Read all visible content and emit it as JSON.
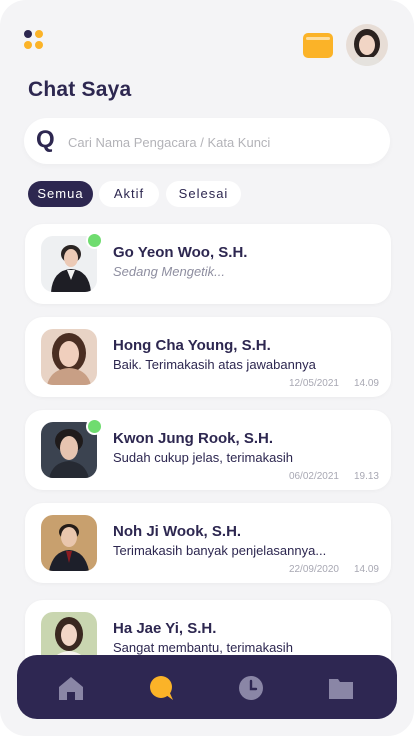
{
  "header": {
    "title": "Chat Saya",
    "menu_icon": "grid-dots-icon",
    "wallet_icon": "wallet-icon",
    "avatar_icon": "profile-avatar"
  },
  "search": {
    "icon_glyph": "Q",
    "placeholder": "Cari Nama Pengacara / Kata Kunci"
  },
  "filters": [
    {
      "label": "Semua",
      "active": true
    },
    {
      "label": "Aktif",
      "active": false
    },
    {
      "label": "Selesai",
      "active": false
    }
  ],
  "chats": [
    {
      "name": "Go Yeon Woo, S.H.",
      "message": "Sedang Mengetik...",
      "date": "",
      "time": "",
      "online": true,
      "typing": true
    },
    {
      "name": "Hong Cha Young, S.H.",
      "message": "Baik. Terimakasih atas jawabannya",
      "date": "12/05/2021",
      "time": "14.09",
      "online": false
    },
    {
      "name": "Kwon Jung Rook, S.H.",
      "message": "Sudah cukup jelas, terimakasih",
      "date": "06/02/2021",
      "time": "19.13",
      "online": true
    },
    {
      "name": "Noh Ji Wook, S.H.",
      "message": "Terimakasih banyak penjelasannya...",
      "date": "22/09/2020",
      "time": "14.09",
      "online": false
    },
    {
      "name": "Ha Jae Yi, S.H.",
      "message": "Sangat membantu, terimakasih",
      "date": "",
      "time": "",
      "online": false
    }
  ],
  "nav": [
    {
      "icon": "home-icon",
      "active": false
    },
    {
      "icon": "chat-icon",
      "active": true
    },
    {
      "icon": "clock-icon",
      "active": false
    },
    {
      "icon": "folder-icon",
      "active": false
    }
  ],
  "colors": {
    "primary": "#2d2750",
    "accent": "#fbb328",
    "online": "#6fdc6f",
    "nav_inactive": "#8a86a6"
  }
}
